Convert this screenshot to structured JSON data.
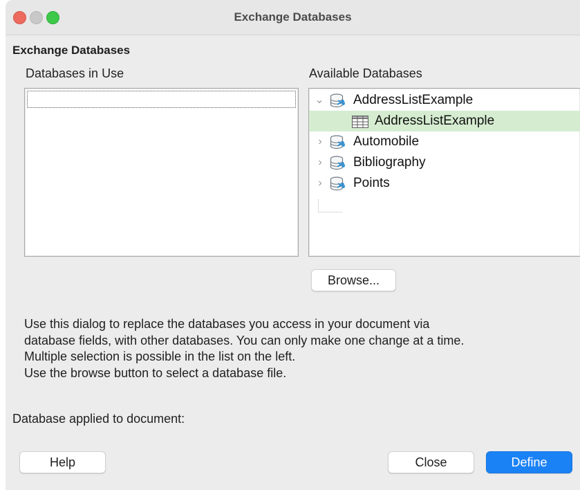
{
  "window": {
    "title": "Exchange Databases"
  },
  "dialog": {
    "section_title": "Exchange Databases",
    "databases_in_use_label": "Databases in Use",
    "available_databases_label": "Available Databases",
    "available_tree": [
      {
        "label": "AddressListExample",
        "type": "database",
        "expanded": true
      },
      {
        "label": "AddressListExample",
        "type": "table",
        "selected": true
      },
      {
        "label": "Automobile",
        "type": "database",
        "expanded": false
      },
      {
        "label": "Bibliography",
        "type": "database",
        "expanded": false
      },
      {
        "label": "Points",
        "type": "database",
        "expanded": false
      }
    ],
    "browse_button": "Browse...",
    "description_lines": [
      "Use this dialog to replace the databases you access in your document via",
      "database fields, with other databases. You can only make one change at a time.",
      "Multiple selection is possible in the list on the left.",
      "Use the browse button to select a database file."
    ],
    "applied_label": "Database applied to document:",
    "buttons": {
      "help": "Help",
      "close": "Close",
      "define": "Define"
    }
  },
  "colors": {
    "accent": "#1b82f5",
    "selected_row": "#d5ecd0"
  },
  "icons": {
    "database": "database-icon",
    "table": "table-icon",
    "expand_down": "chevron-down-icon",
    "expand_right": "chevron-right-icon"
  }
}
